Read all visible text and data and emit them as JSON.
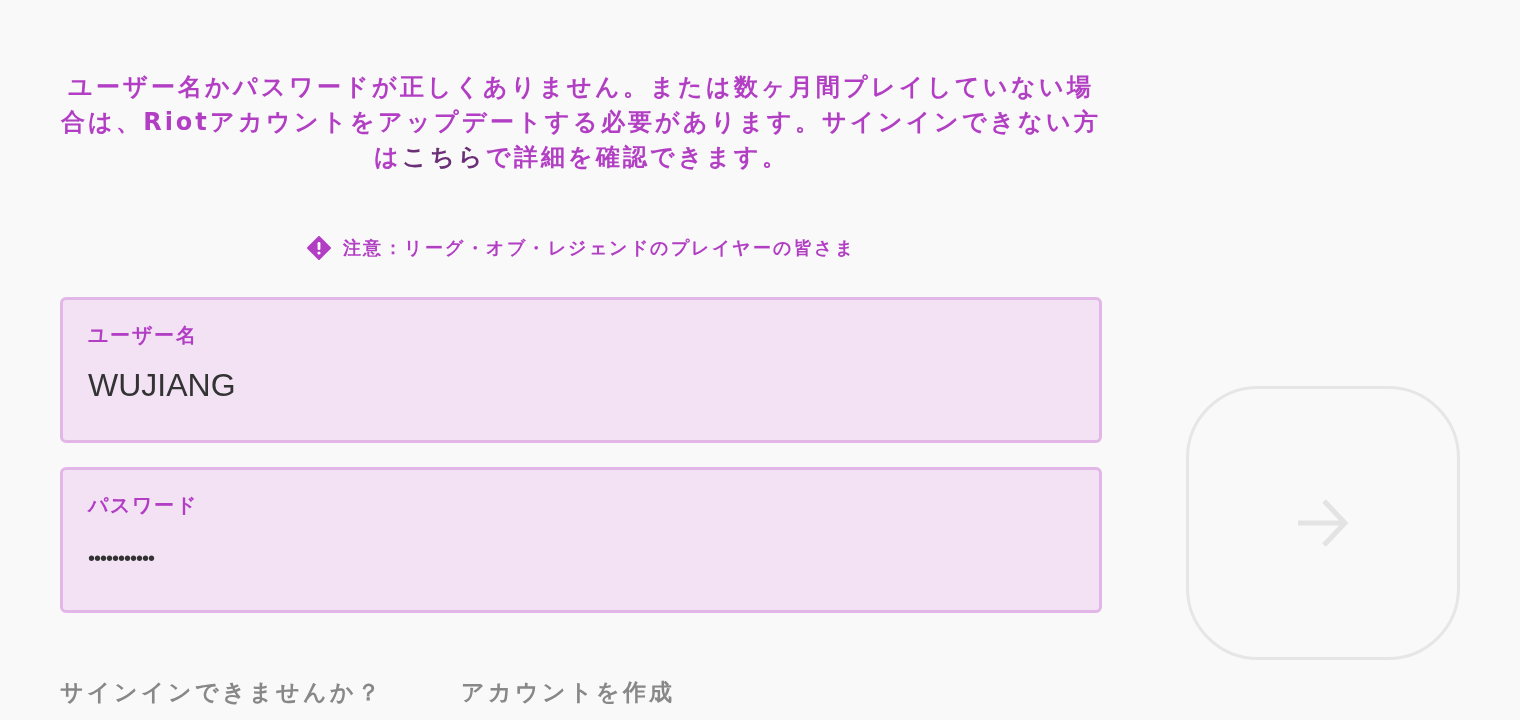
{
  "error": {
    "before": "ユーザー名かパスワードが正しくありません。または数ヶ月間プレイしていない場合は、Riotアカウントをアップデートする必要があります。サインインできない方は",
    "link": "こちら",
    "after": "で詳細を確認できます。"
  },
  "notice": {
    "text": "注意：リーグ・オブ・レジェンドのプレイヤーの皆さま"
  },
  "fields": [
    {
      "label": "ユーザー名",
      "value": "WUJIANG",
      "kind": "text"
    },
    {
      "label": "パスワード",
      "value": "•••••••••••",
      "kind": "password"
    }
  ],
  "submit": {
    "disabled": true
  },
  "links": [
    "サインインできませんか？",
    "アカウントを作成"
  ]
}
